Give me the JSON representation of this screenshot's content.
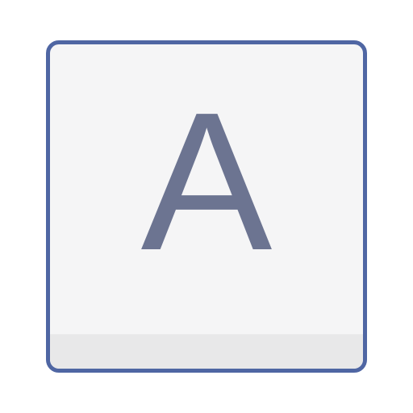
{
  "key": {
    "legend": "A",
    "legend_color": "#6c7491",
    "border_color": "#4f66a3",
    "face_color": "#f5f5f6",
    "base_color": "#e8e8e9"
  }
}
